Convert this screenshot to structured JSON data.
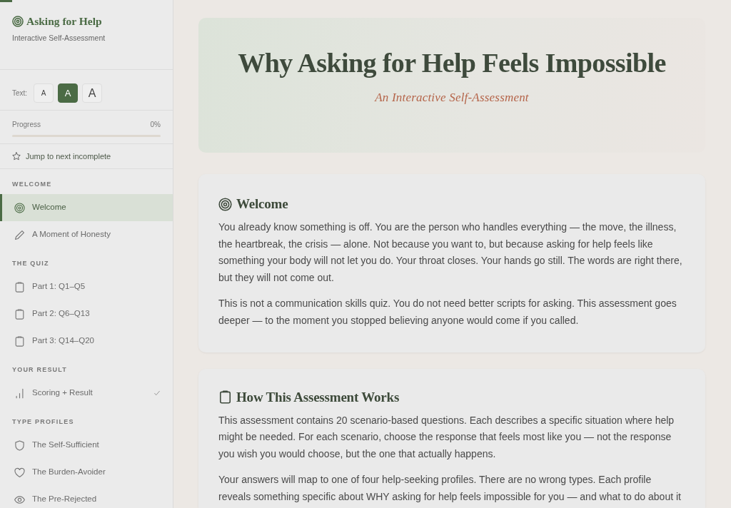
{
  "reading_progress": {
    "level": 0.017
  },
  "sidebar": {
    "brand": {
      "title": "Asking for Help",
      "subtitle": "Interactive Self-Assessment"
    },
    "text_size": {
      "label": "Text:",
      "options": [
        {
          "label": "A",
          "kind": "small",
          "selected": false
        },
        {
          "label": "A",
          "kind": "medium",
          "selected": true
        },
        {
          "label": "A",
          "kind": "large",
          "selected": false
        }
      ]
    },
    "progress": {
      "label": "Progress",
      "reading": "0%",
      "level": 0
    },
    "jump_link": {
      "label": "Jump to next incomplete"
    },
    "sections": [
      {
        "heading": "WELCOME",
        "items": [
          {
            "label": "Welcome",
            "selected": true,
            "checked": false
          },
          {
            "label": "A Moment of Honesty",
            "selected": false,
            "checked": false
          }
        ]
      },
      {
        "heading": "THE QUIZ",
        "items": [
          {
            "label": "Part 1: Q1–Q5",
            "selected": false,
            "checked": false
          },
          {
            "label": "Part 2: Q6–Q13",
            "selected": false,
            "checked": false
          },
          {
            "label": "Part 3: Q14–Q20",
            "selected": false,
            "checked": false
          }
        ]
      },
      {
        "heading": "YOUR RESULT",
        "items": [
          {
            "label": "Scoring + Result",
            "selected": false,
            "checked": true
          }
        ]
      },
      {
        "heading": "TYPE PROFILES",
        "items": [
          {
            "label": "The Self-Sufficient",
            "selected": false,
            "checked": false
          },
          {
            "label": "The Burden-Avoider",
            "selected": false,
            "checked": false
          },
          {
            "label": "The Pre-Rejected",
            "selected": false,
            "checked": false
          }
        ]
      }
    ]
  },
  "hero": {
    "title": "Why Asking for Help Feels Impossible",
    "subtitle": "An Interactive Self-Assessment"
  },
  "cards": [
    {
      "heading": "Welcome",
      "paragraphs": [
        "You already know something is off. You are the person who handles everything — the move, the illness, the heartbreak, the crisis — alone. Not because you want to, but because asking for help feels like something your body will not let you do. Your throat closes. Your hands go still. The words are right there, but they will not come out.",
        "This is not a communication skills quiz. You do not need better scripts for asking. This assessment goes deeper — to the moment you stopped believing anyone would come if you called."
      ]
    },
    {
      "heading": "How This Assessment Works",
      "paragraphs": [
        "This assessment contains 20 scenario-based questions. Each describes a specific situation where help might be needed. For each scenario, choose the response that feels most like you — not the response you wish you would choose, but the one that actually happens.",
        "Your answers will map to one of four help-seeking profiles. There are no wrong types. Each profile reveals something specific about WHY asking for help feels impossible for you — and what to do about it"
      ]
    }
  ]
}
